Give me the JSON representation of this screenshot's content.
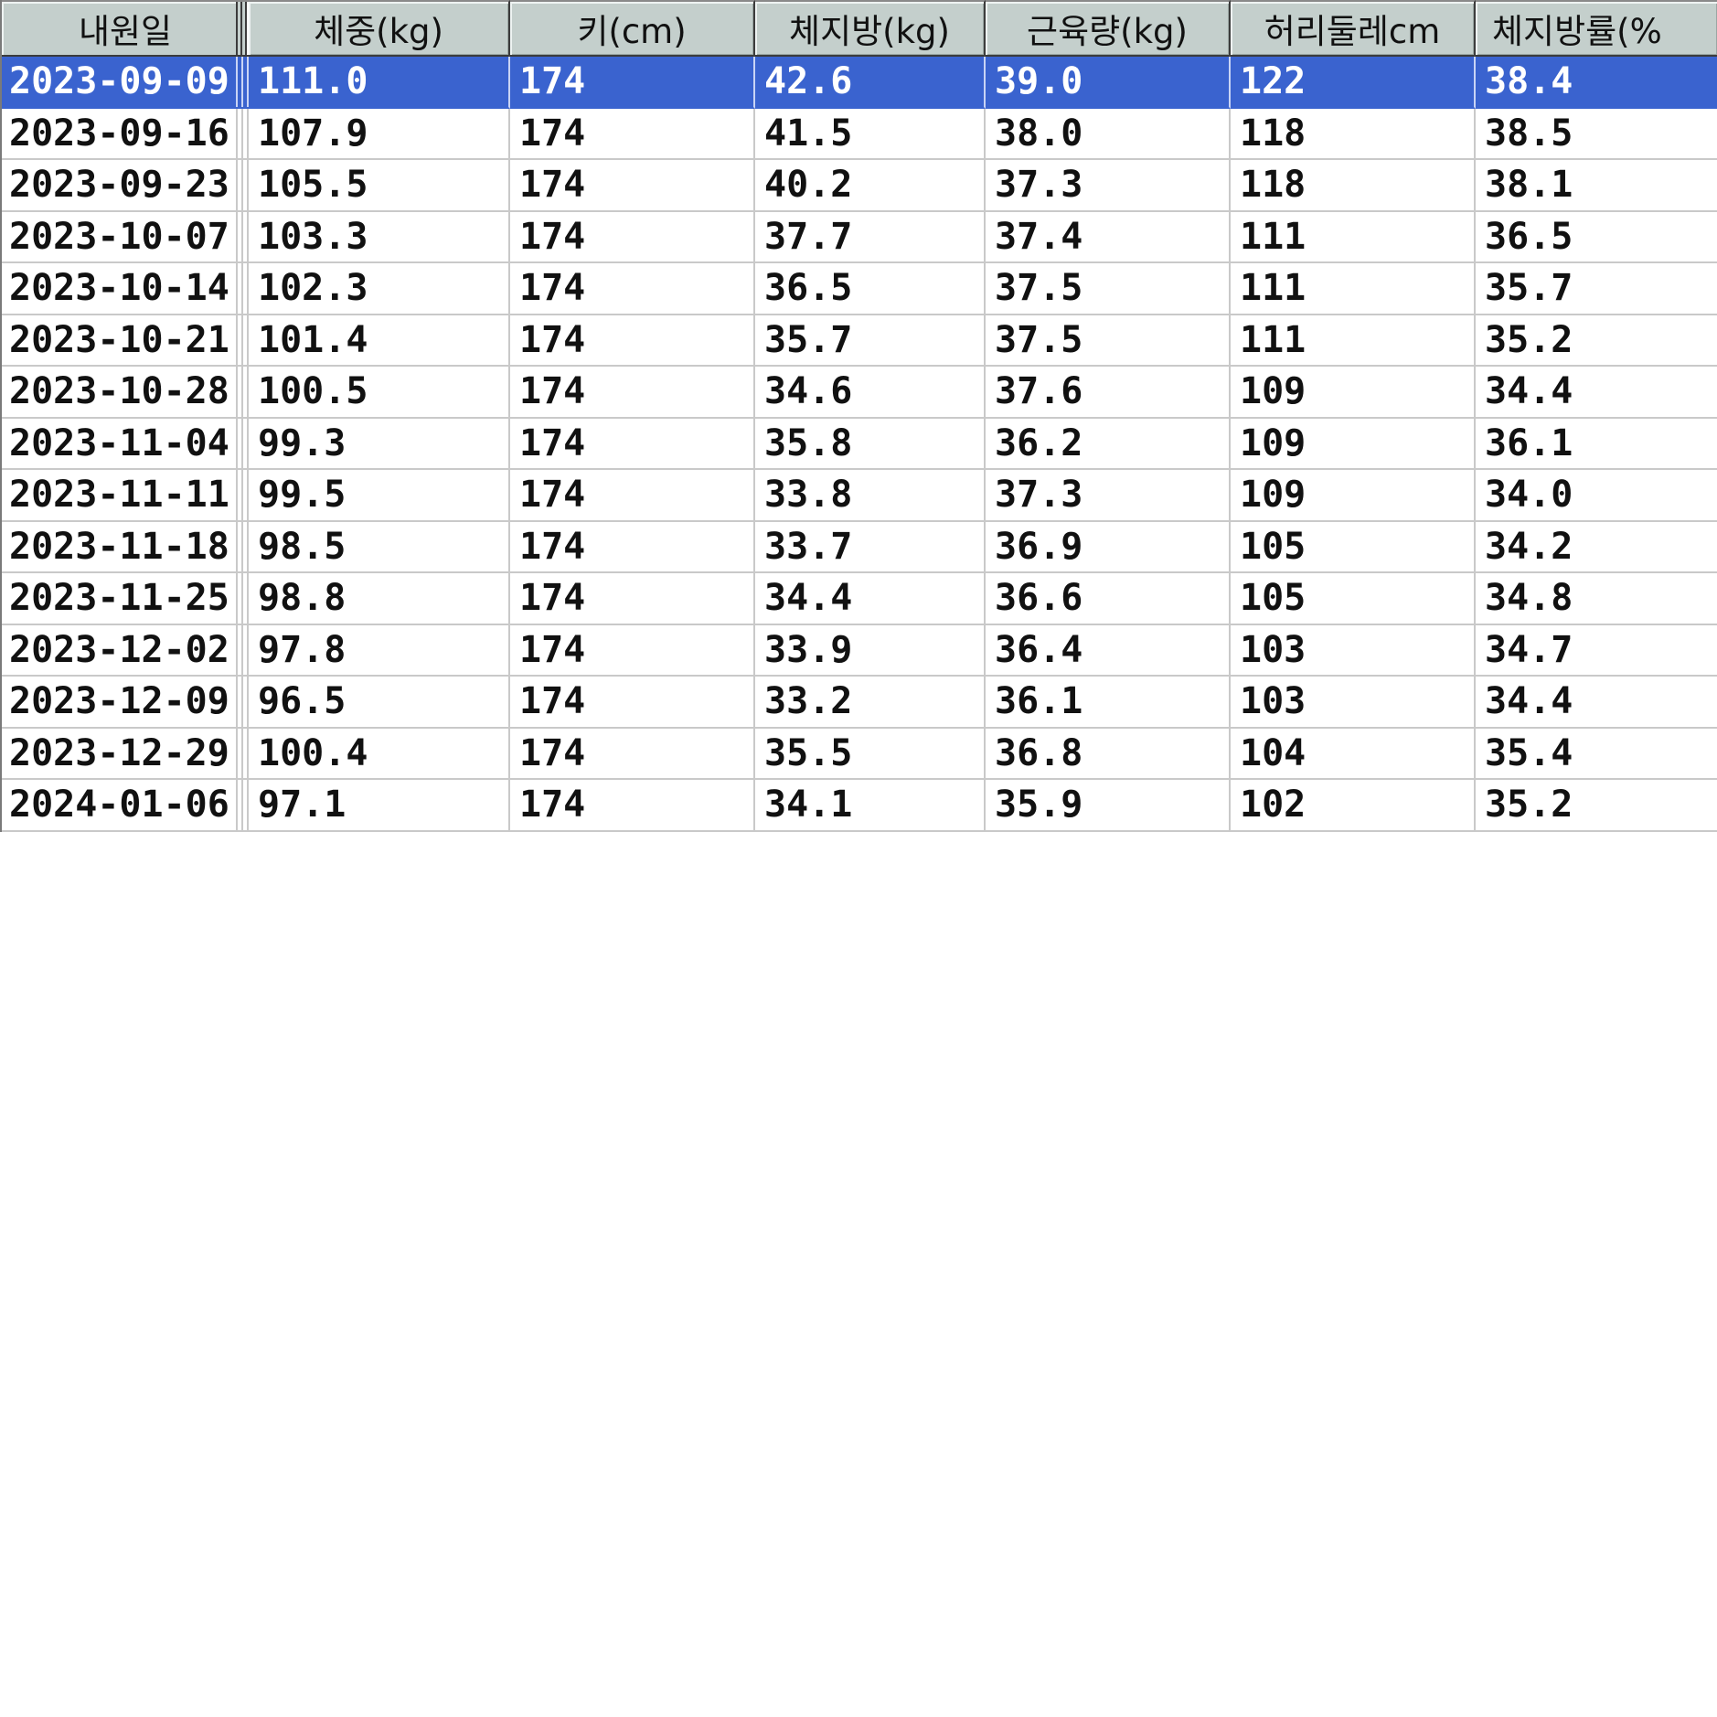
{
  "table": {
    "columns": [
      "내원일",
      "체중(kg)",
      "키(cm)",
      "체지방(kg)",
      "근육량(kg)",
      "허리둘레cm",
      "체지방률(%"
    ],
    "selected_row": 0,
    "rows": [
      [
        "2023-09-09",
        "111.0",
        "174",
        "42.6",
        "39.0",
        "122",
        "38.4"
      ],
      [
        "2023-09-16",
        "107.9",
        "174",
        "41.5",
        "38.0",
        "118",
        "38.5"
      ],
      [
        "2023-09-23",
        "105.5",
        "174",
        "40.2",
        "37.3",
        "118",
        "38.1"
      ],
      [
        "2023-10-07",
        "103.3",
        "174",
        "37.7",
        "37.4",
        "111",
        "36.5"
      ],
      [
        "2023-10-14",
        "102.3",
        "174",
        "36.5",
        "37.5",
        "111",
        "35.7"
      ],
      [
        "2023-10-21",
        "101.4",
        "174",
        "35.7",
        "37.5",
        "111",
        "35.2"
      ],
      [
        "2023-10-28",
        "100.5",
        "174",
        "34.6",
        "37.6",
        "109",
        "34.4"
      ],
      [
        "2023-11-04",
        "99.3",
        "174",
        "35.8",
        "36.2",
        "109",
        "36.1"
      ],
      [
        "2023-11-11",
        "99.5",
        "174",
        "33.8",
        "37.3",
        "109",
        "34.0"
      ],
      [
        "2023-11-18",
        "98.5",
        "174",
        "33.7",
        "36.9",
        "105",
        "34.2"
      ],
      [
        "2023-11-25",
        "98.8",
        "174",
        "34.4",
        "36.6",
        "105",
        "34.8"
      ],
      [
        "2023-12-02",
        "97.8",
        "174",
        "33.9",
        "36.4",
        "103",
        "34.7"
      ],
      [
        "2023-12-09",
        "96.5",
        "174",
        "33.2",
        "36.1",
        "103",
        "34.4"
      ],
      [
        "2023-12-29",
        "100.4",
        "174",
        "35.5",
        "36.8",
        "104",
        "35.4"
      ],
      [
        "2024-01-06",
        "97.1",
        "174",
        "34.1",
        "35.9",
        "102",
        "35.2"
      ]
    ]
  },
  "colors": {
    "header_bg": "#c4cfcc",
    "selected_bg": "#3a63cf",
    "grid_line": "#c9c9c9"
  }
}
